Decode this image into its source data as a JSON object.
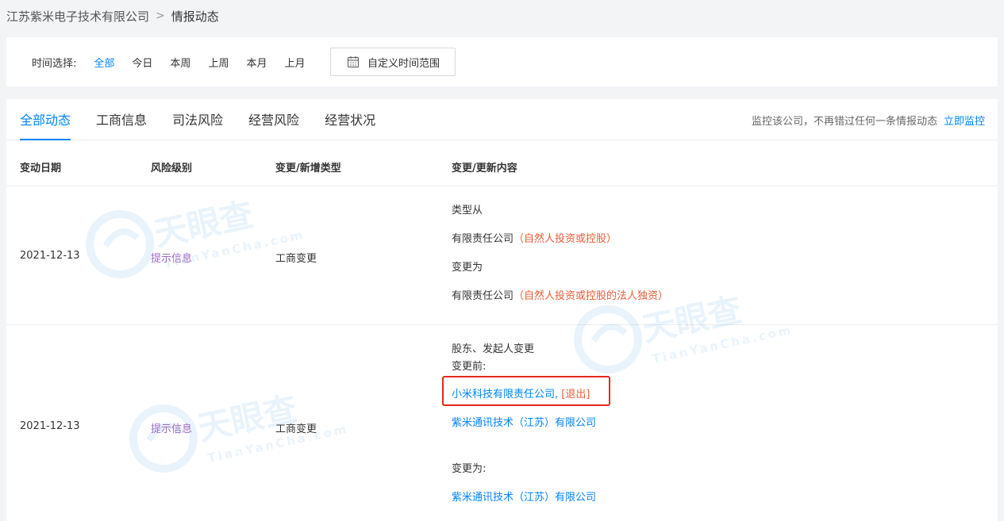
{
  "breadcrumb": {
    "company": "江苏紫米电子技术有限公司",
    "separator": ">",
    "current": "情报动态"
  },
  "time_filter": {
    "label": "时间选择:",
    "options": [
      "全部",
      "今日",
      "本周",
      "上周",
      "本月",
      "上月"
    ],
    "active": "全部",
    "custom_label": "自定义时间范围"
  },
  "tabs": [
    {
      "label": "全部动态",
      "active": true
    },
    {
      "label": "工商信息",
      "active": false
    },
    {
      "label": "司法风险",
      "active": false
    },
    {
      "label": "经营风险",
      "active": false
    },
    {
      "label": "经营状况",
      "active": false
    }
  ],
  "monitor": {
    "text": "监控该公司，不再错过任何一条情报动态",
    "link": "立即监控"
  },
  "table": {
    "headers": [
      "变动日期",
      "风险级别",
      "变更/新增类型",
      "变更/更新内容"
    ],
    "rows": [
      {
        "date": "2021-12-13",
        "risk": "提示信息",
        "type": "工商变更",
        "content": {
          "l1": "类型从",
          "l2_main": "有限责任公司",
          "l2_paren": "（自然人投资或控股）",
          "l3": "变更为",
          "l4_main": "有限责任公司",
          "l4_paren_a": "（自然人投资或控股",
          "l4_red": "的法人独资",
          "l4_paren_b": "）"
        }
      },
      {
        "date": "2021-12-13",
        "risk": "提示信息",
        "type": "工商变更",
        "content": {
          "title": "股东、发起人变更",
          "before_label": "变更前:",
          "before_1_link": "小米科技有限责任公司,",
          "before_1_tag": " [退出]",
          "before_2_link": "紫米通讯技术（江苏）有限公司",
          "after_label": "变更为:",
          "after_1_link": "紫米通讯技术（江苏）有限公司"
        }
      }
    ]
  },
  "watermark": {
    "brand": "天眼查",
    "domain": "TianYanCha.com"
  },
  "colors": {
    "accent": "#0084ff",
    "risk_purple": "#9b6bc4",
    "change_red": "#e85d37",
    "highlight_red": "#e8271c"
  }
}
